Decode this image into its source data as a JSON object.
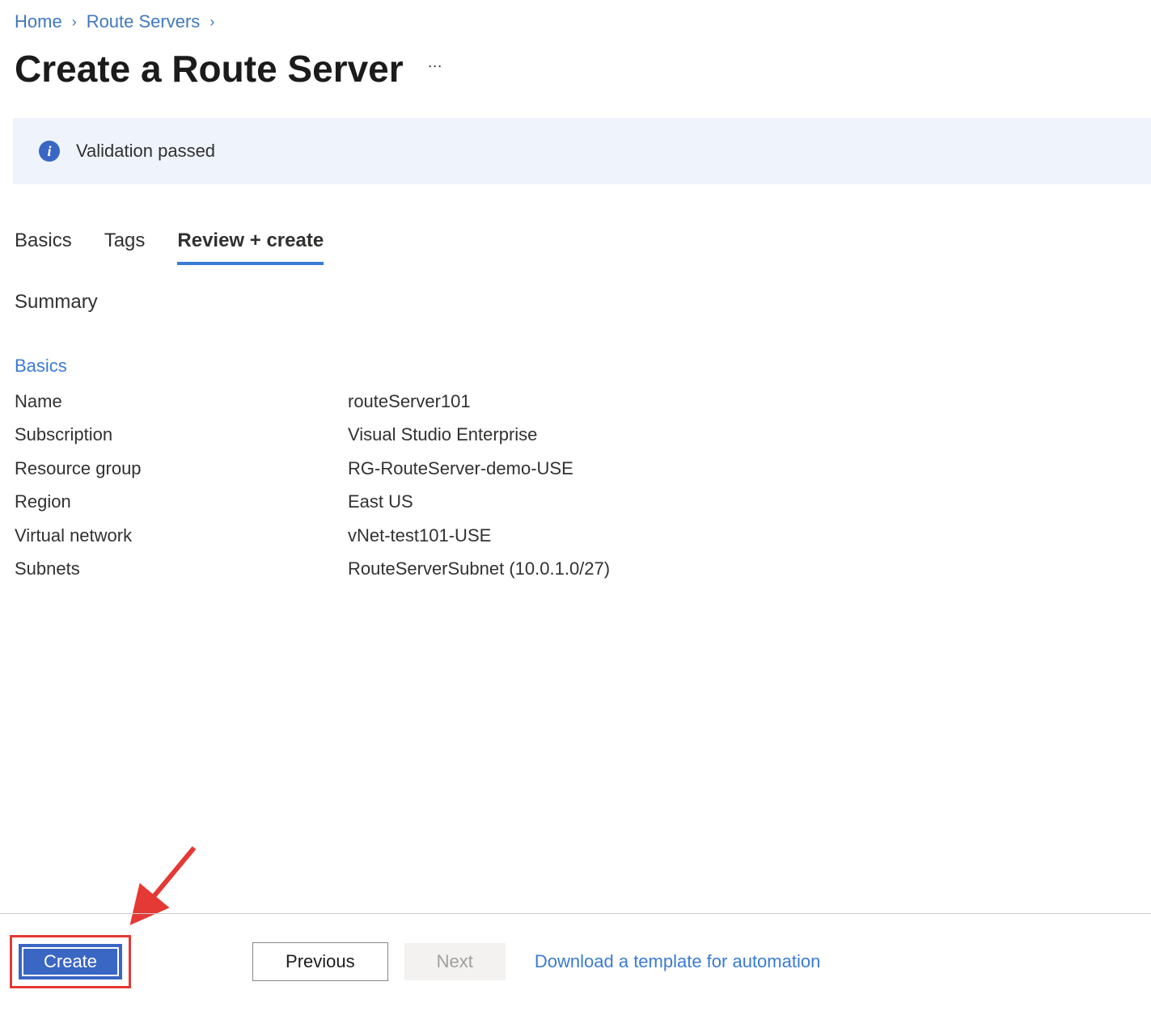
{
  "breadcrumb": {
    "items": [
      "Home",
      "Route Servers"
    ]
  },
  "page": {
    "title": "Create a Route Server",
    "more": "⋯"
  },
  "validation": {
    "message": "Validation passed"
  },
  "tabs": {
    "basics": "Basics",
    "tags": "Tags",
    "review": "Review + create"
  },
  "summary": {
    "heading": "Summary",
    "section": "Basics",
    "rows": [
      {
        "key": "Name",
        "value": "routeServer101"
      },
      {
        "key": "Subscription",
        "value": "Visual Studio Enterprise"
      },
      {
        "key": "Resource group",
        "value": "RG-RouteServer-demo-USE"
      },
      {
        "key": "Region",
        "value": "East US"
      },
      {
        "key": "Virtual network",
        "value": "vNet-test101-USE"
      },
      {
        "key": "Subnets",
        "value": "RouteServerSubnet (10.0.1.0/27)"
      }
    ]
  },
  "footer": {
    "create": "Create",
    "previous": "Previous",
    "next": "Next",
    "download": "Download a template for automation"
  }
}
